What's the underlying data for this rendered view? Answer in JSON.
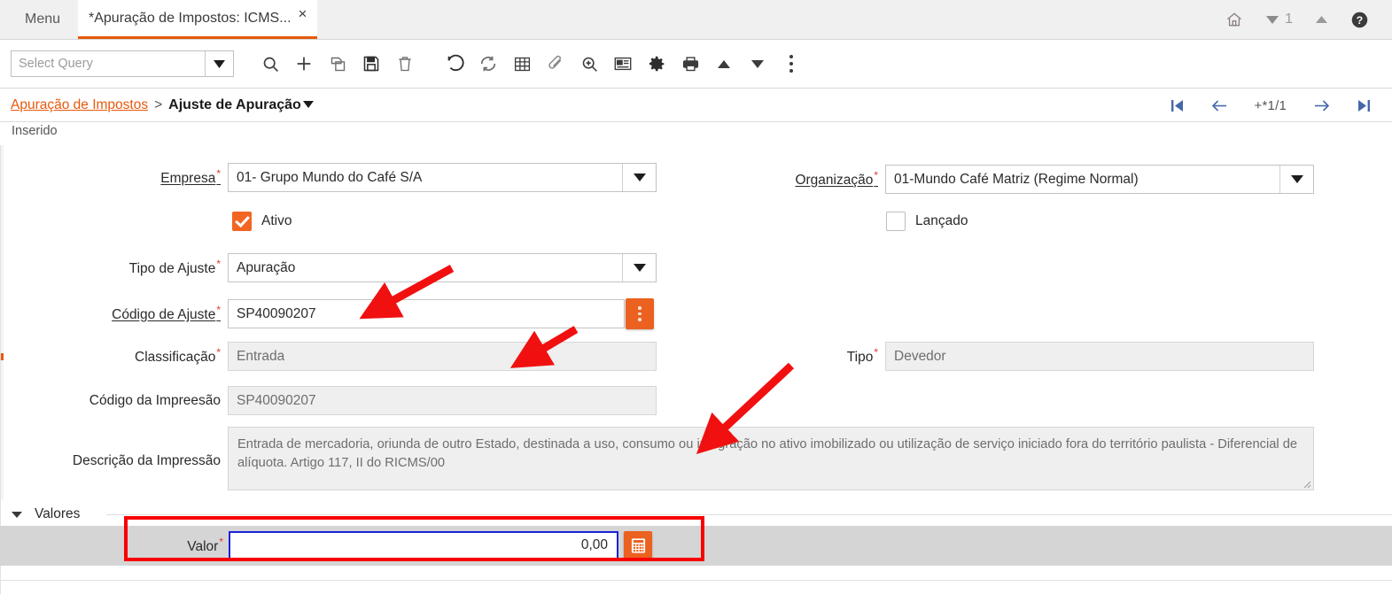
{
  "window": {
    "menu_label": "Menu",
    "tab_title": "*Apuração de Impostos: ICMS...",
    "tab_close": "×",
    "home_icon": "home-icon",
    "window_number": "1",
    "help_icon": "help-icon"
  },
  "toolbar": {
    "query_value": "",
    "query_placeholder": "Select Query",
    "icons": [
      "search-icon",
      "add-icon",
      "copy-icon",
      "save-icon",
      "delete-icon",
      "undo-icon",
      "refresh-icon",
      "grid-icon",
      "attachment-icon",
      "zoom-icon",
      "report-icon",
      "settings-icon",
      "print-icon",
      "arrow-up-icon",
      "arrow-down-icon",
      "kebab-menu-icon"
    ]
  },
  "breadcrumb": {
    "parent": "Apuração de Impostos",
    "separator": ">",
    "current": "Ajuste de Apuração"
  },
  "record_nav": {
    "first": "first-record-icon",
    "prev": "previous-record-icon",
    "counter": "+*1/1",
    "next": "next-record-icon",
    "last": "last-record-icon"
  },
  "status": {
    "text": "Inserido"
  },
  "form": {
    "empresa": {
      "label": "Empresa",
      "required": "*",
      "value": "01- Grupo Mundo do Café S/A"
    },
    "organizacao": {
      "label": "Organização",
      "required": "*",
      "value": "01-Mundo Café Matriz (Regime Normal)"
    },
    "ativo": {
      "label": "Ativo",
      "checked": true
    },
    "lancado": {
      "label": "Lançado",
      "checked": false
    },
    "tipo_ajuste": {
      "label": "Tipo de Ajuste",
      "required": "*",
      "value": "Apuração"
    },
    "codigo_ajuste": {
      "label": "Código de Ajuste",
      "required": "*",
      "value": "SP40090207"
    },
    "classificacao": {
      "label": "Classificação",
      "required": "*",
      "value": "Entrada"
    },
    "tipo": {
      "label": "Tipo",
      "required": "*",
      "value": "Devedor"
    },
    "codigo_impressao": {
      "label": "Código da Impreesão",
      "value": "SP40090207"
    },
    "descricao_impressao": {
      "label": "Descrição da Impressão",
      "value": "Entrada de mercadoria, oriunda de outro Estado, destinada a uso, consumo ou integração no ativo imobilizado ou utilização de serviço iniciado fora do território paulista - Diferencial de alíquota. Artigo 117, II do RICMS/00"
    }
  },
  "valores_section": {
    "title": "Valores",
    "valor": {
      "label": "Valor",
      "required": "*",
      "value": "0,00",
      "calculator_icon": "calculator-icon"
    }
  },
  "colors": {
    "accent_orange": "#e8580c",
    "button_orange": "#eb6120",
    "highlight_red": "#f80000",
    "focus_blue": "#1922d8",
    "required_red": "#e03a2f",
    "nav_blue": "#4668a8",
    "band_gray": "#d5d5d5"
  },
  "annotations": {
    "arrows": [
      {
        "name": "arrow-to-codigo-de-ajuste"
      },
      {
        "name": "arrow-to-classificacao"
      },
      {
        "name": "arrow-to-descricao-da-impressao"
      }
    ],
    "highlight_box": {
      "name": "valor-highlight-box"
    }
  }
}
